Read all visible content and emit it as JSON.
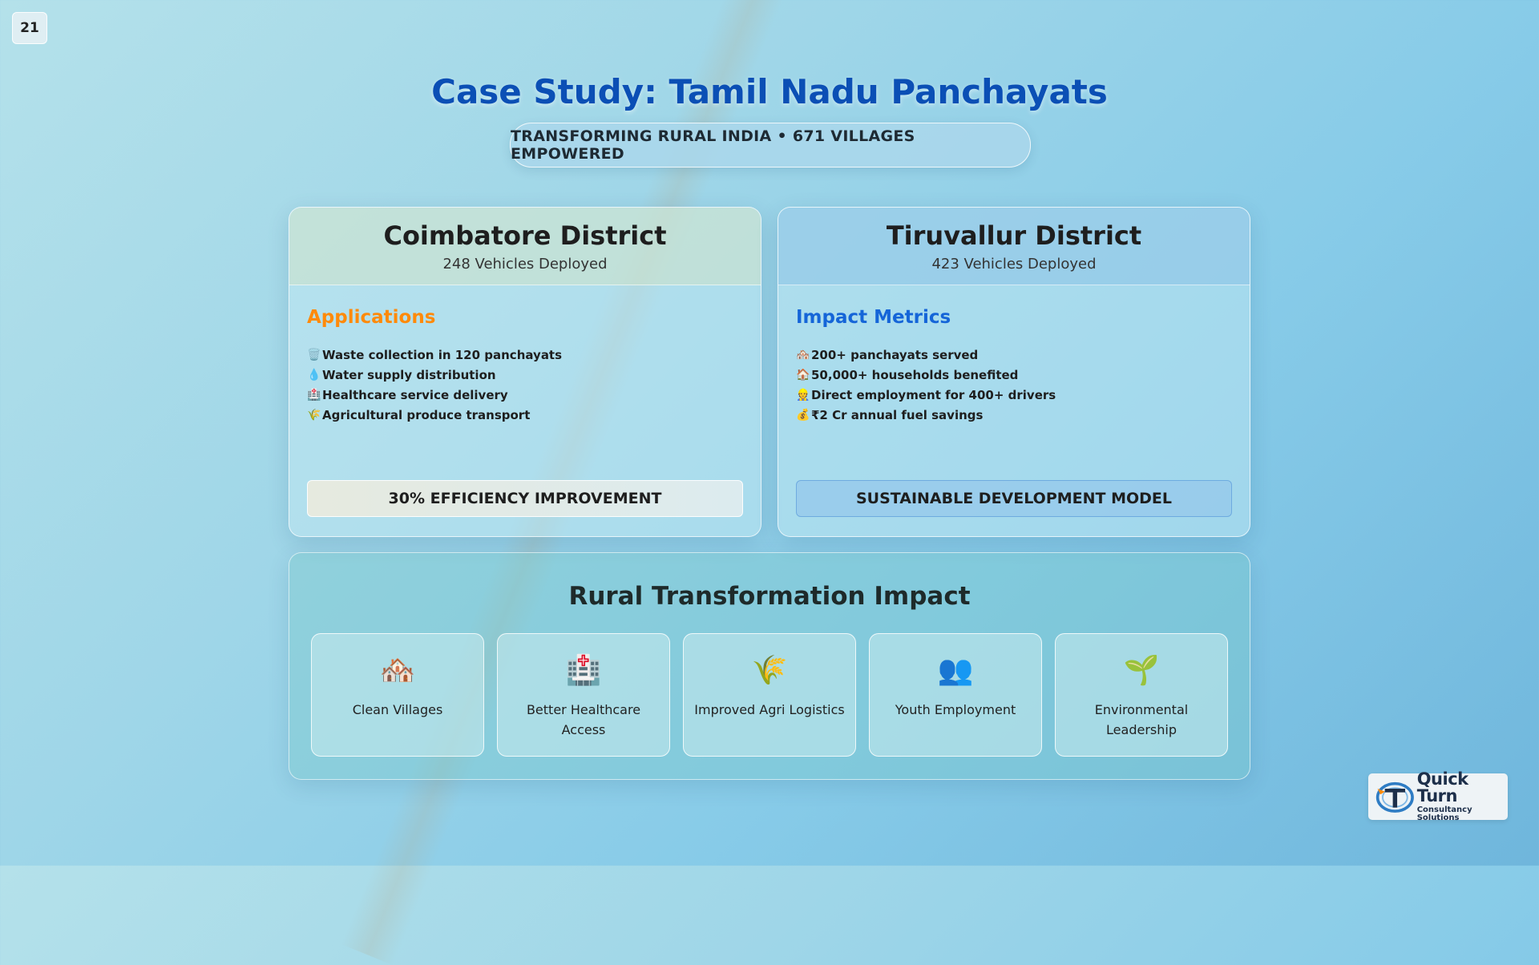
{
  "page_number": "21",
  "title": "Case Study: Tamil Nadu Panchayats",
  "subtitle": "TRANSFORMING RURAL INDIA • 671 VILLAGES EMPOWERED",
  "left_card": {
    "title": "Coimbatore District",
    "subtitle": "248 Vehicles Deployed",
    "section_title": "Applications",
    "items": [
      {
        "icon": "🗑️",
        "icon_name": "trash-icon",
        "text": "Waste collection in 120 panchayats"
      },
      {
        "icon": "💧",
        "icon_name": "water-drop-icon",
        "text": "Water supply distribution"
      },
      {
        "icon": "🏥",
        "icon_name": "hospital-icon",
        "text": "Healthcare service delivery"
      },
      {
        "icon": "🌾",
        "icon_name": "rice-icon",
        "text": "Agricultural produce transport"
      }
    ],
    "banner": "30% EFFICIENCY IMPROVEMENT"
  },
  "right_card": {
    "title": "Tiruvallur District",
    "subtitle": "423 Vehicles Deployed",
    "section_title": "Impact Metrics",
    "items": [
      {
        "icon": "🏘️",
        "icon_name": "houses-icon",
        "text": "200+ panchayats served"
      },
      {
        "icon": "🏠",
        "icon_name": "house-icon",
        "text": "50,000+ households benefited"
      },
      {
        "icon": "👷",
        "icon_name": "worker-icon",
        "text": "Direct employment for 400+ drivers"
      },
      {
        "icon": "💰",
        "icon_name": "money-bag-icon",
        "text": "₹2 Cr annual fuel savings"
      }
    ],
    "banner": "SUSTAINABLE DEVELOPMENT MODEL"
  },
  "impact": {
    "title": "Rural Transformation Impact",
    "tiles": [
      {
        "icon": "🏘️",
        "icon_name": "village-icon",
        "label": "Clean Villages"
      },
      {
        "icon": "🏥",
        "icon_name": "hospital-icon",
        "label": "Better Healthcare Access"
      },
      {
        "icon": "🌾",
        "icon_name": "rice-icon",
        "label": "Improved Agri Logistics"
      },
      {
        "icon": "👥",
        "icon_name": "people-icon",
        "label": "Youth Employment"
      },
      {
        "icon": "🌱",
        "icon_name": "seedling-icon",
        "label": "Environmental Leadership"
      }
    ]
  },
  "logo": {
    "name": "Quick Turn",
    "tagline": "Consultancy Solutions",
    "colors": {
      "primary": "#1d2f4a",
      "accent": "#2e7cc4",
      "orange": "#ff8a0a"
    }
  },
  "colors": {
    "title": "#0b4fb5",
    "applications": "#ff8a0a",
    "impact_metrics": "#1565d8"
  }
}
